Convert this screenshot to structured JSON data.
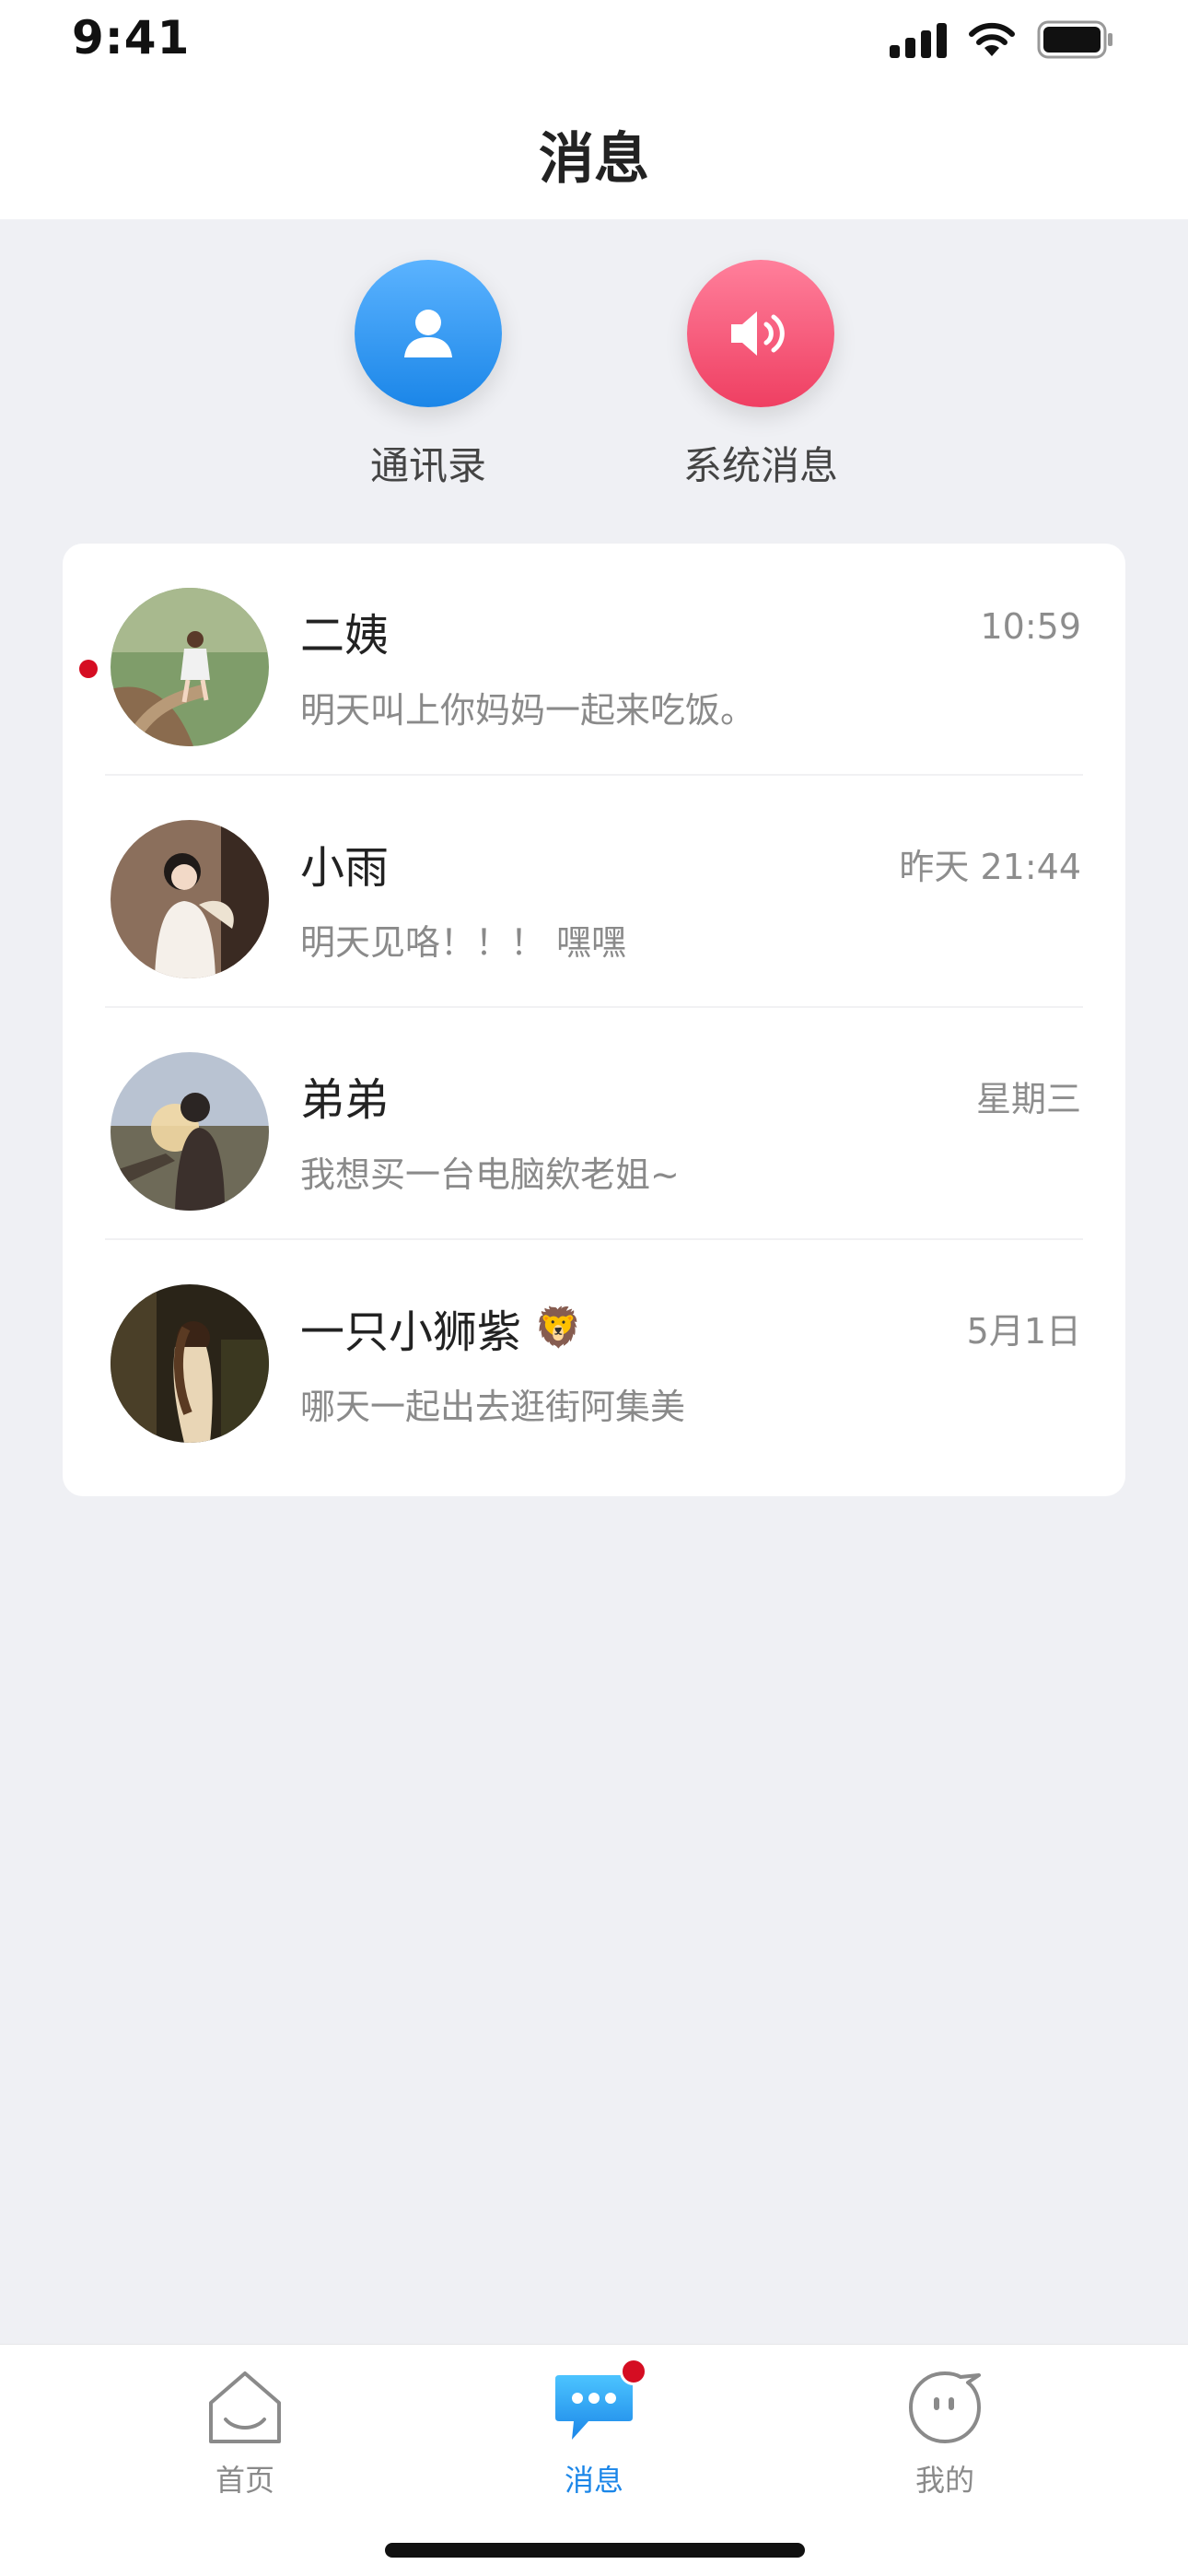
{
  "status_bar": {
    "time": "9:41"
  },
  "header": {
    "title": "消息"
  },
  "quick_actions": [
    {
      "label": "通讯录",
      "icon": "person-icon",
      "color": "#2f96ef"
    },
    {
      "label": "系统消息",
      "icon": "speaker-icon",
      "color": "#f25576"
    }
  ],
  "conversations": [
    {
      "name": "二姨",
      "time": "10:59",
      "preview": "明天叫上你妈妈一起来吃饭。",
      "unread": true
    },
    {
      "name": "小雨",
      "time": "昨天 21:44",
      "preview": "明天见咯！！！ 嘿嘿",
      "unread": false
    },
    {
      "name": "弟弟",
      "time": "星期三",
      "preview": "我想买一台电脑欸老姐~",
      "unread": false
    },
    {
      "name": "一只小狮紫",
      "emoji": "🦁",
      "time": "5月1日",
      "preview": "哪天一起出去逛街阿集美",
      "unread": false
    }
  ],
  "tabbar": {
    "items": [
      {
        "label": "首页",
        "icon": "home-icon",
        "active": false
      },
      {
        "label": "消息",
        "icon": "chat-bubble-icon",
        "active": true,
        "badge": true
      },
      {
        "label": "我的",
        "icon": "profile-face-icon",
        "active": false
      }
    ]
  },
  "colors": {
    "accent": "#1b86e8",
    "badge": "#d50d22",
    "background": "#eff0f4"
  }
}
